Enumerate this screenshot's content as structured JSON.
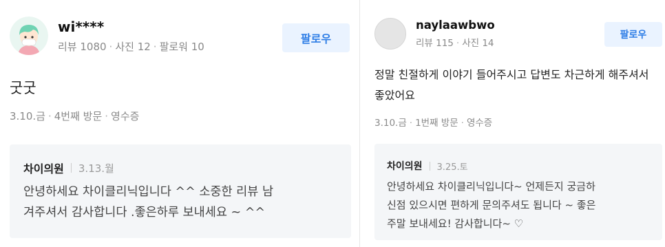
{
  "reviews": [
    {
      "nickname": "wi****",
      "stats": [
        "리뷰 1080",
        "사진 12",
        "팔로워 10"
      ],
      "follow_label": "팔로우",
      "text": "굿굿",
      "meta": [
        "3.10.금",
        "4번째 방문",
        "영수증"
      ],
      "reply": {
        "name": "차이의원",
        "date": "3.13.월",
        "lines": [
          "안녕하세요 차이클리닉입니다 ^^ 소중한 리뷰 남",
          "겨주셔서 감사합니다 .좋은하루 보내세요 ~ ^^"
        ]
      }
    },
    {
      "nickname": "naylaawbwo",
      "stats": [
        "리뷰 115",
        "사진 14"
      ],
      "follow_label": "팔로우",
      "text": "정말 친절하게 이야기 들어주시고 답변도 차근하게 해주셔서 좋았어요",
      "meta": [
        "3.10.금",
        "1번째 방문",
        "영수증"
      ],
      "reply": {
        "name": "차이의원",
        "date": "3.25.토",
        "lines": [
          "안녕하세요 차이클리닉입니다~ 언제든지 궁금하",
          "신점 있으시면 편하게 문의주셔도 됩니다 ~ 좋은",
          "주말 보내세요! 감사합니다~ ♡"
        ]
      }
    }
  ]
}
